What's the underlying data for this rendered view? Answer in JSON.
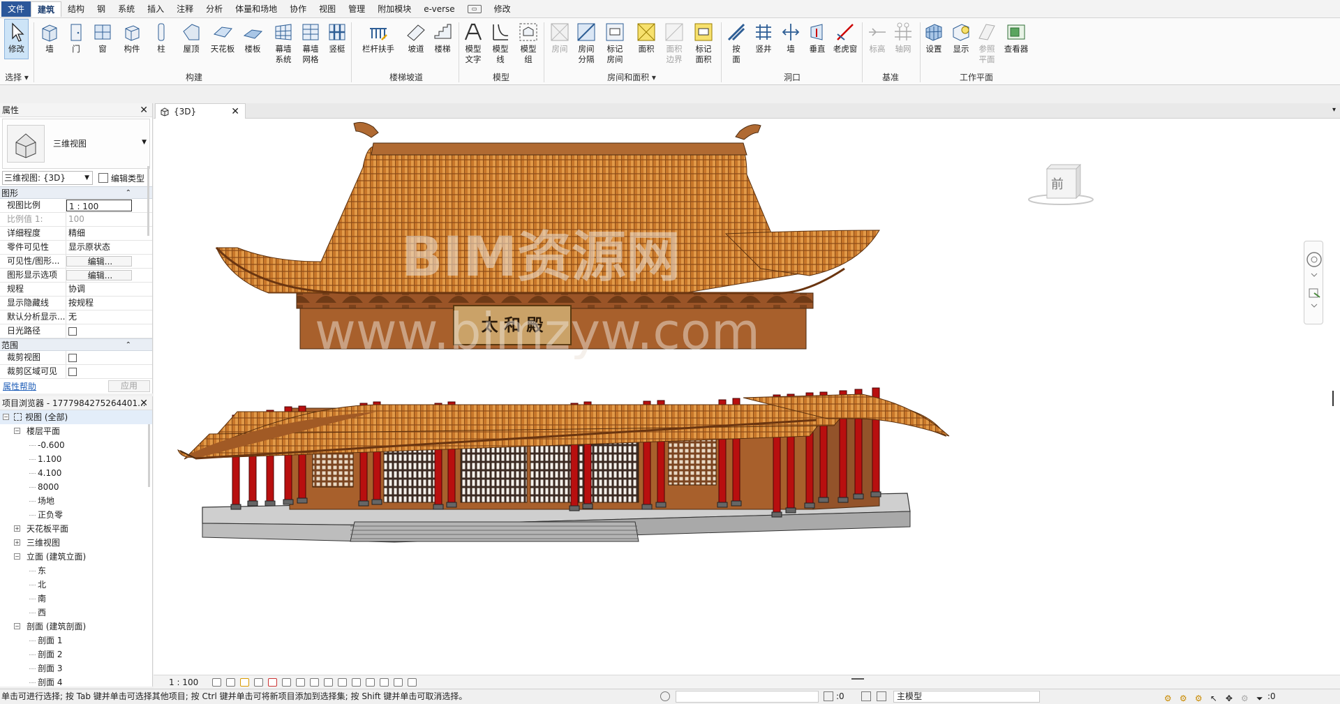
{
  "menu": [
    "文件",
    "建筑",
    "结构",
    "钢",
    "系统",
    "插入",
    "注释",
    "分析",
    "体量和场地",
    "协作",
    "视图",
    "管理",
    "附加模块",
    "e-verse",
    "修改"
  ],
  "ribbon": {
    "select": {
      "modify": "修改",
      "select": "选择"
    },
    "build": {
      "title": "构建",
      "wall": "墙",
      "door": "门",
      "window": "窗",
      "component": "构件",
      "column": "柱",
      "roof": "屋顶",
      "ceiling": "天花板",
      "floor": "楼板",
      "curtain_system": "幕墙\n系统",
      "curtain_grid": "幕墙\n网格",
      "mullion": "竖梃"
    },
    "circulation": {
      "title": "楼梯坡道",
      "railing": "栏杆扶手",
      "ramp": "坡道",
      "stair": "楼梯"
    },
    "model": {
      "title": "模型",
      "text": "模型\n文字",
      "line": "模型\n线",
      "group": "模型\n组"
    },
    "room": {
      "title": "房间和面积",
      "room": "房间",
      "separator": "房间\n分隔",
      "tag_room": "标记\n房间",
      "area": "面积",
      "area_boundary": "面积\n边界",
      "tag_area": "标记\n面积"
    },
    "opening": {
      "title": "洞口",
      "by_face": "按\n面",
      "shaft": "竖井",
      "wall": "墙",
      "vertical": "垂直",
      "dormer": "老虎窗"
    },
    "datum": {
      "title": "基准",
      "level": "标高",
      "grid": "轴网"
    },
    "workplane": {
      "title": "工作平面",
      "set": "设置",
      "show": "显示",
      "ref_plane": "参照\n平面",
      "viewer": "查看器"
    }
  },
  "properties": {
    "title": "属性",
    "type_name": "三维视图",
    "view_selector": "三维视图: {3D}",
    "edit_type": "编辑类型",
    "sections": {
      "graphics": "图形",
      "extents": "范围"
    },
    "rows": [
      {
        "k": "视图比例",
        "v": "1 : 100",
        "style": "box"
      },
      {
        "k": "比例值 1:",
        "v": "100",
        "style": "gray"
      },
      {
        "k": "详细程度",
        "v": "精细"
      },
      {
        "k": "零件可见性",
        "v": "显示原状态"
      },
      {
        "k": "可见性/图形...",
        "v": "编辑...",
        "style": "btn"
      },
      {
        "k": "图形显示选项",
        "v": "编辑...",
        "style": "btn"
      },
      {
        "k": "规程",
        "v": "协调"
      },
      {
        "k": "显示隐藏线",
        "v": "按规程"
      },
      {
        "k": "默认分析显示...",
        "v": "无"
      },
      {
        "k": "日光路径",
        "v": "",
        "style": "chk"
      }
    ],
    "extent_rows": [
      {
        "k": "裁剪视图",
        "v": "",
        "style": "chk"
      },
      {
        "k": "裁剪区域可见",
        "v": "",
        "style": "chk"
      }
    ],
    "help": "属性帮助",
    "apply": "应用"
  },
  "browser": {
    "title": "项目浏览器 - 1777984275264401...",
    "nodes": [
      {
        "t": "视图 (全部)",
        "lvl": 0,
        "tog": "−",
        "icon": true
      },
      {
        "t": "楼层平面",
        "lvl": 1,
        "tog": "−"
      },
      {
        "t": "-0.600",
        "lvl": 2
      },
      {
        "t": "1.100",
        "lvl": 2
      },
      {
        "t": "4.100",
        "lvl": 2
      },
      {
        "t": "8000",
        "lvl": 2
      },
      {
        "t": "场地",
        "lvl": 2
      },
      {
        "t": "正负零",
        "lvl": 2
      },
      {
        "t": "天花板平面",
        "lvl": 1,
        "tog": "+"
      },
      {
        "t": "三维视图",
        "lvl": 1,
        "tog": "+"
      },
      {
        "t": "立面 (建筑立面)",
        "lvl": 1,
        "tog": "−"
      },
      {
        "t": "东",
        "lvl": 2
      },
      {
        "t": "北",
        "lvl": 2
      },
      {
        "t": "南",
        "lvl": 2
      },
      {
        "t": "西",
        "lvl": 2
      },
      {
        "t": "剖面 (建筑剖面)",
        "lvl": 1,
        "tog": "−"
      },
      {
        "t": "剖面 1",
        "lvl": 2
      },
      {
        "t": "剖面 2",
        "lvl": 2
      },
      {
        "t": "剖面 3",
        "lvl": 2
      },
      {
        "t": "剖面 4",
        "lvl": 2
      }
    ]
  },
  "view": {
    "tab": "{3D}",
    "viewcube_face": "前",
    "watermark_big": "BIM资源网",
    "watermark_url": "www.bimzyw.com",
    "plaque": "太 和 殿",
    "scale": "1 : 100"
  },
  "status": {
    "message": "单击可进行选择; 按 Tab 键并单击可选择其他项目; 按 Ctrl 键并单击可将新项目添加到选择集; 按 Shift 键并单击可取消选择。",
    "count1": ":0",
    "workset": "主模型",
    "count2": ":0"
  },
  "colors": {
    "roof": "#c8772a",
    "wall": "#a8602c",
    "column": "#b80f0f",
    "accent": "#2b579a"
  }
}
